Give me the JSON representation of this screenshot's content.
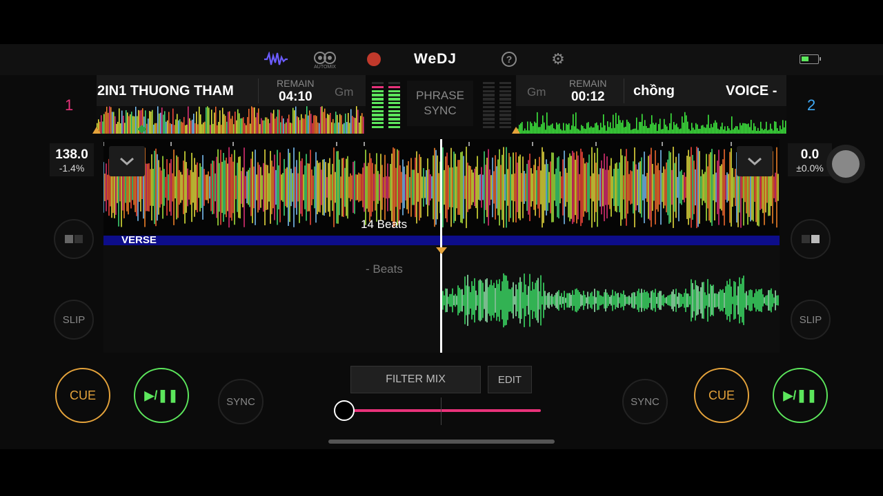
{
  "app": {
    "name": "WeDJ"
  },
  "topbar": {
    "automix_label": "AUTOMIX",
    "battery_color": "#5ce65c"
  },
  "deck1": {
    "number": "1",
    "title": "2IN1 THUONG THAM",
    "remain_label": "REMAIN",
    "remain_time": "04:10",
    "key": "Gm",
    "bpm": "138.0",
    "pitch": "-1.4%",
    "beats_label": "14 Beats",
    "phrase_label": "VERSE",
    "slip_label": "SLIP",
    "sync_label": "SYNC",
    "cue_label": "CUE",
    "play_label": "▶/❚❚",
    "number_color": "#e8327a"
  },
  "deck2": {
    "number": "2",
    "title_left": "chồng",
    "title_right": "VOICE -",
    "remain_label": "REMAIN",
    "remain_time": "00:12",
    "key": "Gm",
    "bpm": "0.0",
    "pitch": "±0.0%",
    "beats_label": "- Beats",
    "slip_label": "SLIP",
    "sync_label": "SYNC",
    "cue_label": "CUE",
    "play_label": "▶/❚❚",
    "number_color": "#3fa9f5"
  },
  "center": {
    "phrase_sync_line1": "PHRASE",
    "phrase_sync_line2": "SYNC",
    "filter_mix_label": "FILTER MIX",
    "edit_label": "EDIT",
    "crossfader_value": 0.0
  }
}
